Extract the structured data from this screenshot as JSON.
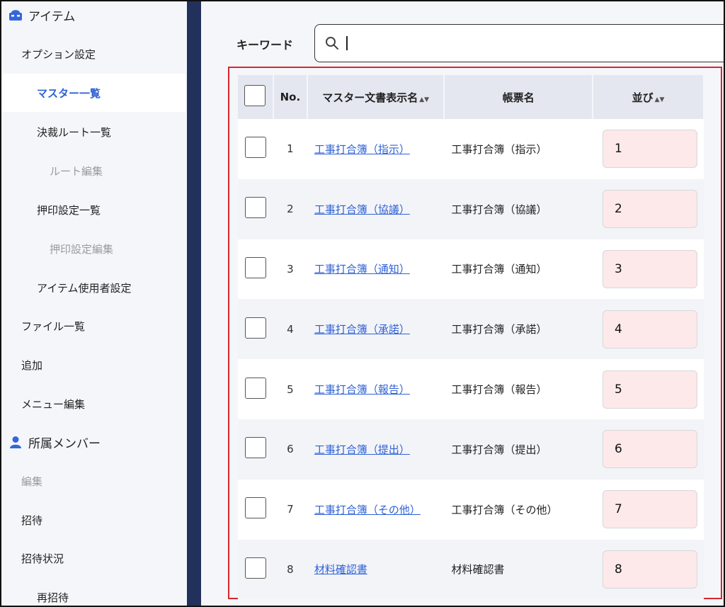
{
  "sidebar": {
    "items": [
      {
        "label": "アイテム",
        "icon": "item-icon",
        "state": "section"
      },
      {
        "label": "オプション設定",
        "state": "normal"
      },
      {
        "label": "マスター一覧",
        "state": "active"
      },
      {
        "label": "決裁ルート一覧",
        "state": "normal"
      },
      {
        "label": "ルート編集",
        "state": "muted"
      },
      {
        "label": "押印設定一覧",
        "state": "normal"
      },
      {
        "label": "押印設定編集",
        "state": "muted"
      },
      {
        "label": "アイテム使用者設定",
        "state": "normal"
      },
      {
        "label": "ファイル一覧",
        "state": "normal"
      },
      {
        "label": "追加",
        "state": "normal"
      },
      {
        "label": "メニュー編集",
        "state": "normal"
      },
      {
        "label": "所属メンバー",
        "icon": "person-icon",
        "state": "section"
      },
      {
        "label": "編集",
        "state": "muted"
      },
      {
        "label": "招待",
        "state": "normal"
      },
      {
        "label": "招待状況",
        "state": "normal"
      },
      {
        "label": "再招待",
        "state": "normal"
      }
    ]
  },
  "search": {
    "label": "キーワード",
    "value": "",
    "icon": "search-icon"
  },
  "table": {
    "headers": {
      "no": "No.",
      "name": "マスター文書表示名",
      "form": "帳票名",
      "order": "並び"
    },
    "rows": [
      {
        "no": "1",
        "name": "工事打合簿（指示）",
        "form": "工事打合簿（指示）",
        "order": "1"
      },
      {
        "no": "2",
        "name": "工事打合簿（協議）",
        "form": "工事打合簿（協議）",
        "order": "2"
      },
      {
        "no": "3",
        "name": "工事打合簿（通知）",
        "form": "工事打合簿（通知）",
        "order": "3"
      },
      {
        "no": "4",
        "name": "工事打合簿（承諾）",
        "form": "工事打合簿（承諾）",
        "order": "4"
      },
      {
        "no": "5",
        "name": "工事打合簿（報告）",
        "form": "工事打合簿（報告）",
        "order": "5"
      },
      {
        "no": "6",
        "name": "工事打合簿（提出）",
        "form": "工事打合簿（提出）",
        "order": "6"
      },
      {
        "no": "7",
        "name": "工事打合簿（その他）",
        "form": "工事打合簿（その他）",
        "order": "7"
      },
      {
        "no": "8",
        "name": "材料確認書",
        "form": "材料確認書",
        "order": "8"
      }
    ]
  },
  "colors": {
    "sidebar_bg": "#f5f6fa",
    "divider": "#22315c",
    "accent": "#2f62d6",
    "highlight_border": "#d8272d",
    "order_field_bg": "#fde9ea"
  }
}
